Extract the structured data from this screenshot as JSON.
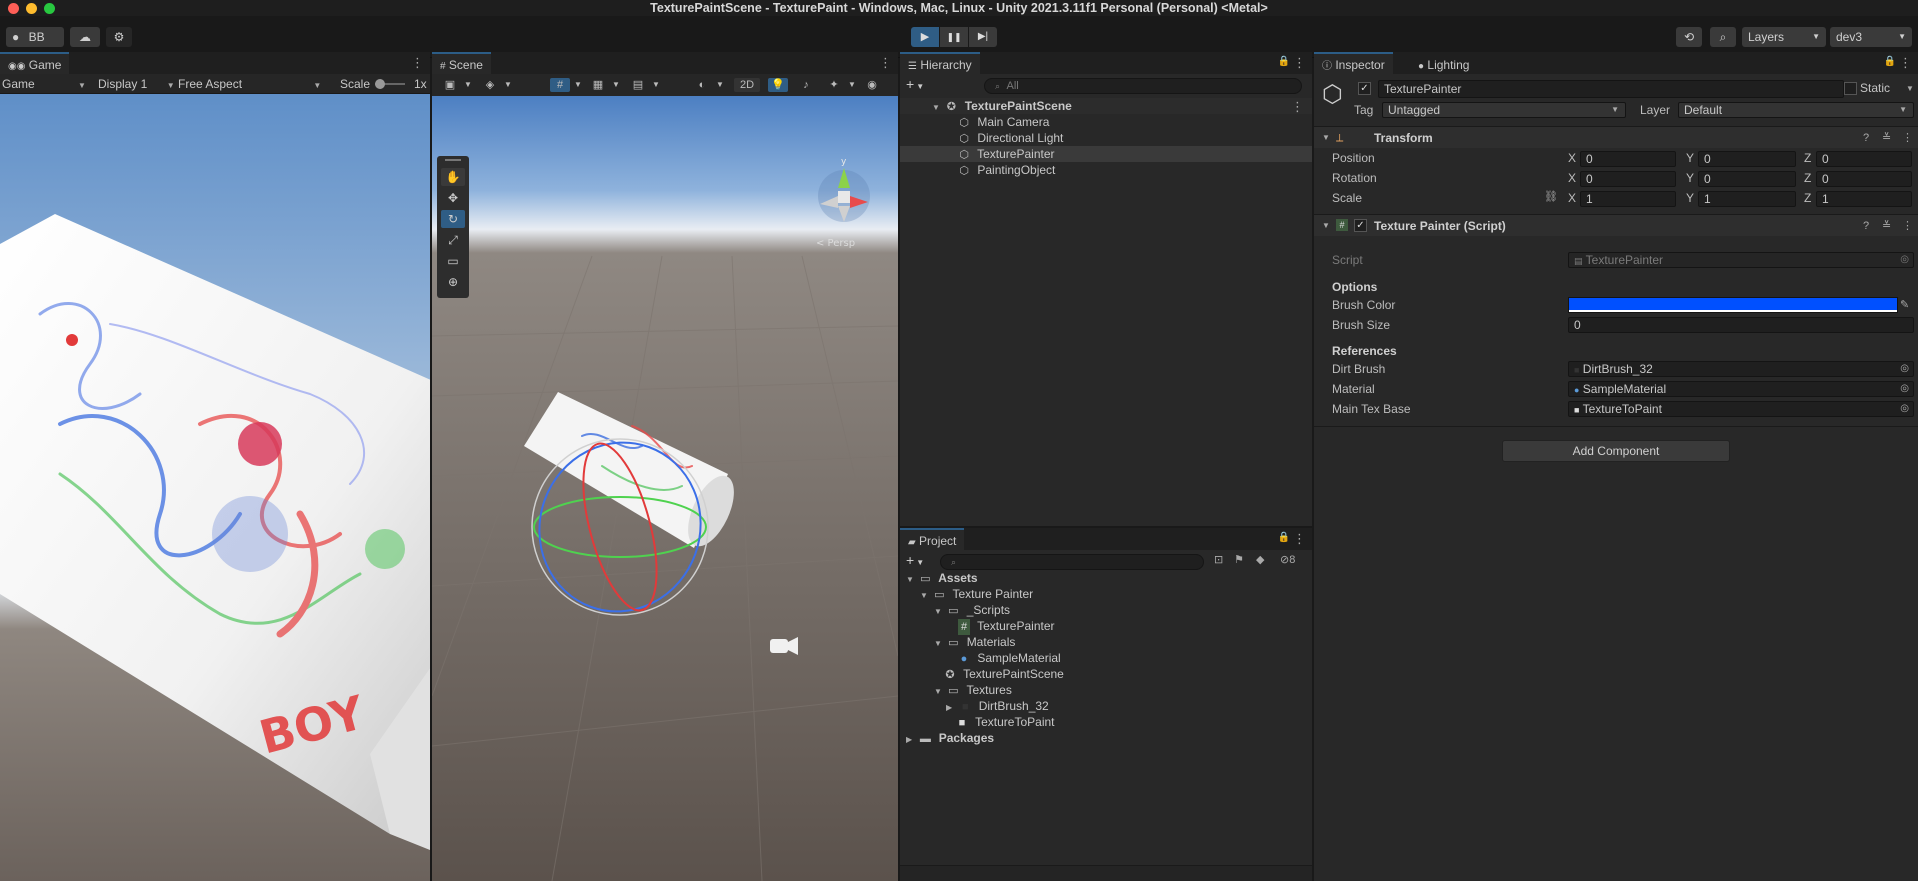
{
  "window": {
    "title": "TexturePaintScene - TexturePaint - Windows, Mac, Linux - Unity 2021.3.11f1 Personal (Personal) <Metal>"
  },
  "toolbar": {
    "account": "BB",
    "play": "▶",
    "pause": "❚❚",
    "step": "▶|",
    "layers": "Layers",
    "layout": "dev3"
  },
  "game": {
    "tab": "Game",
    "mode": "Game",
    "display": "Display 1",
    "aspect": "Free Aspect",
    "scale_label": "Scale",
    "scale_value": "1x",
    "drawn_text": "BOY"
  },
  "scene": {
    "tab": "Scene",
    "btn_2d": "2D",
    "gizmo_label": "< Persp",
    "gizmo_y": "y"
  },
  "hierarchy": {
    "tab": "Hierarchy",
    "search_placeholder": "All",
    "root": "TexturePaintScene",
    "items": [
      "Main Camera",
      "Directional Light",
      "TexturePainter",
      "PaintingObject"
    ]
  },
  "project": {
    "tab": "Project",
    "hidden_count": "8",
    "tree": {
      "assets": "Assets",
      "texture_painter": "Texture Painter",
      "scripts": "_Scripts",
      "script_file": "TexturePainter",
      "materials": "Materials",
      "material_file": "SampleMaterial",
      "scene_file": "TexturePaintScene",
      "textures": "Textures",
      "dirt": "DirtBrush_32",
      "tex": "TextureToPaint",
      "packages": "Packages"
    }
  },
  "inspector": {
    "tab": "Inspector",
    "tab2": "Lighting",
    "object_name": "TexturePainter",
    "static_label": "Static",
    "tag_label": "Tag",
    "tag_value": "Untagged",
    "layer_label": "Layer",
    "layer_value": "Default",
    "transform": {
      "title": "Transform",
      "position": "Position",
      "rotation": "Rotation",
      "scale": "Scale",
      "axis_x": "X",
      "axis_y": "Y",
      "axis_z": "Z",
      "pos": [
        "0",
        "0",
        "0"
      ],
      "rot": [
        "0",
        "0",
        "0"
      ],
      "scl": [
        "1",
        "1",
        "1"
      ]
    },
    "script": {
      "title": "Texture Painter (Script)",
      "script_label": "Script",
      "script_value": "TexturePainter",
      "options_header": "Options",
      "brush_color_label": "Brush Color",
      "brush_color": "#0050ff",
      "brush_size_label": "Brush Size",
      "brush_size": "0",
      "references_header": "References",
      "dirt_label": "Dirt Brush",
      "dirt_value": "DirtBrush_32",
      "material_label": "Material",
      "material_value": "SampleMaterial",
      "maintex_label": "Main Tex Base",
      "maintex_value": "TextureToPaint"
    },
    "add_component": "Add Component"
  }
}
